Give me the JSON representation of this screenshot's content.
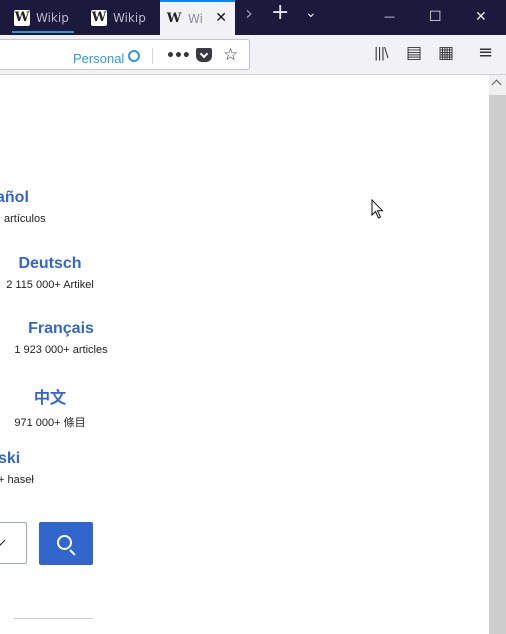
{
  "tabs": [
    {
      "label": "Wikip",
      "icon": "wikipedia-favicon",
      "active": false
    },
    {
      "label": "Wikip",
      "icon": "wikipedia-favicon",
      "active": false
    },
    {
      "label": "Wi",
      "icon": "wikipedia-favicon",
      "active": true
    }
  ],
  "tab_favicon_glyph": "W",
  "tab_close_glyph": "✕",
  "tabstrip": {
    "scroll_glyph": "›",
    "new_tab_glyph": "+",
    "list_glyph": "⌄"
  },
  "window_controls": {
    "minimize": "—",
    "maximize": "☐",
    "close": "✕"
  },
  "urlbar": {
    "container_label": "Personal",
    "container_color": "#2f9bd5"
  },
  "toolbar_glyphs": {
    "page_actions": "•••",
    "bookmark": "☆",
    "library": "|||\\",
    "sidebar": "▤",
    "extensions": "▦",
    "menu": "≡"
  },
  "languages": [
    {
      "name": "Español",
      "visible_name": "añol",
      "count": "artículos"
    },
    {
      "name": "Deutsch",
      "visible_name": "Deutsch",
      "count": "2 115 000+ Artikel"
    },
    {
      "name": "Français",
      "visible_name": "Français",
      "count": "1 923 000+ articles"
    },
    {
      "name": "中文",
      "visible_name": "中文",
      "count": "971 000+ 條目"
    },
    {
      "name": "Polski",
      "visible_name": "ski",
      "count": "+ haseł"
    }
  ],
  "search": {
    "button_color": "#3366cc"
  },
  "colors": {
    "link": "#3366cc",
    "titlebar": "#1b1a3c",
    "toolbar": "#f2f2f6",
    "active_tab_accent": "#0a84ff"
  }
}
